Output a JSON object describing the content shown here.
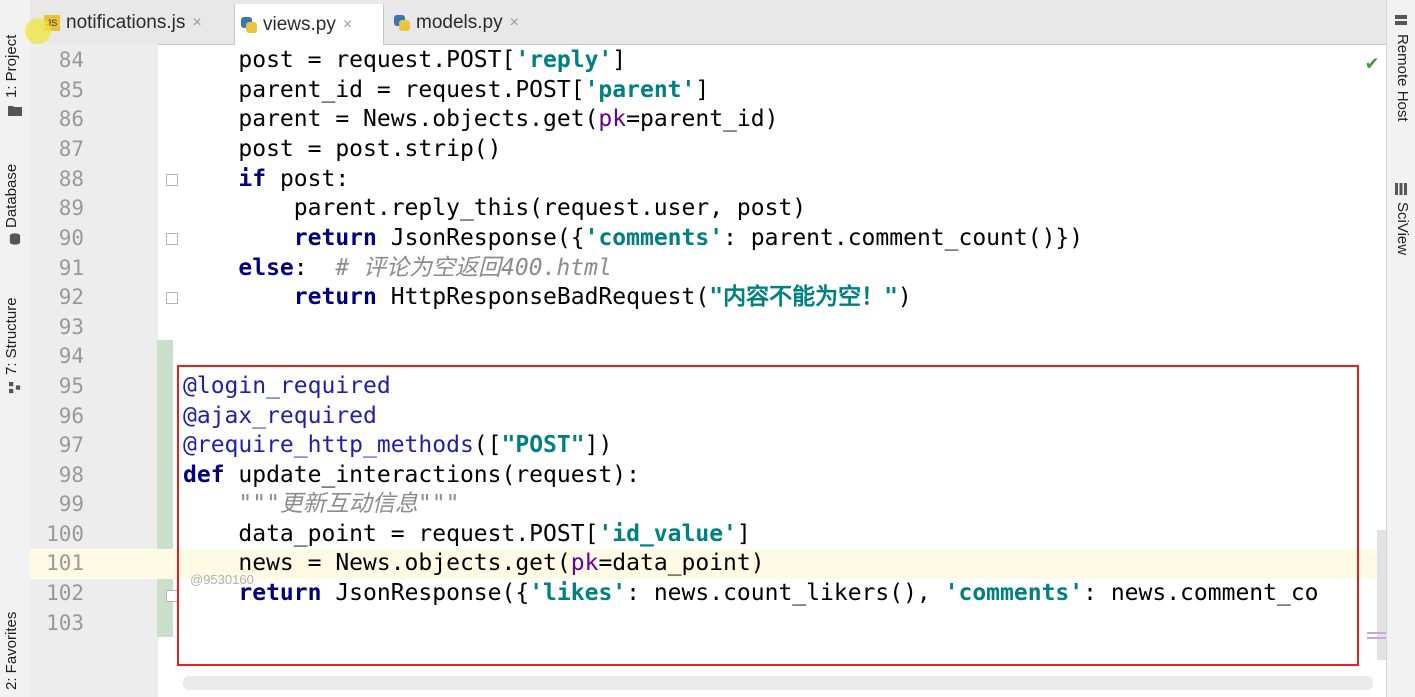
{
  "left_panel": {
    "tabs": [
      {
        "label": "1: Project"
      },
      {
        "label": "Database"
      },
      {
        "label": "7: Structure"
      },
      {
        "label": "2: Favorites"
      }
    ]
  },
  "right_panel": {
    "tabs": [
      {
        "label": "Remote Host"
      },
      {
        "label": "SciView"
      }
    ]
  },
  "editor_tabs": [
    {
      "label": "notifications.js",
      "icon": "js-file-icon",
      "active": false,
      "close": "×"
    },
    {
      "label": "views.py",
      "icon": "python-file-icon",
      "active": true,
      "close": "×"
    },
    {
      "label": "models.py",
      "icon": "python-file-icon",
      "active": false,
      "close": "×"
    }
  ],
  "line_numbers": [
    "84",
    "85",
    "86",
    "87",
    "88",
    "89",
    "90",
    "91",
    "92",
    "93",
    "94",
    "95",
    "96",
    "97",
    "98",
    "99",
    "100",
    "101",
    "102",
    "103"
  ],
  "watermark": "@9530160",
  "status": {
    "check": "✔"
  },
  "colors": {
    "keyword": "#000080",
    "string": "#008080",
    "comment": "#8c8c8c",
    "highlight_box": "#e32121",
    "current_line": "#fffae3"
  },
  "code": {
    "l84": {
      "a": "    post = request.POST[",
      "s": "'reply'",
      "b": "]"
    },
    "l85": {
      "a": "    parent_id = request.POST[",
      "s": "'parent'",
      "b": "]"
    },
    "l86": {
      "a": "    parent = News.objects.get(",
      "p": "pk",
      "b": "=parent_id)"
    },
    "l87": {
      "a": "    post = post.strip()"
    },
    "l88": {
      "kw": "if",
      "b": " post:"
    },
    "l89": {
      "a": "        parent.reply_this(request.user, post)"
    },
    "l90": {
      "kw": "return",
      "a": " JsonResponse({",
      "s": "'comments'",
      "b": ": parent.comment_count()})"
    },
    "l91": {
      "kw": "else",
      "a": ":  ",
      "c": "# 评论为空返回400.html"
    },
    "l92": {
      "kw": "return",
      "a": " HttpResponseBadRequest(",
      "s": "\"内容不能为空！\"",
      "b": ")"
    },
    "l95": {
      "d": "@login_required"
    },
    "l96": {
      "d": "@ajax_required"
    },
    "l97": {
      "d": "@require_http_methods",
      "a": "([",
      "s": "\"POST\"",
      "b": "])"
    },
    "l98": {
      "kw": "def",
      "a": " update_interactions(request):"
    },
    "l99": {
      "c": "\"\"\"更新互动信息\"\"\""
    },
    "l100": {
      "a": "data_point = request.POST[",
      "s": "'id_value'",
      "b": "]"
    },
    "l101": {
      "a": "news = News.objects.get(",
      "p": "pk",
      "b": "=data_point)"
    },
    "l102": {
      "kw": "return",
      "a": " JsonResponse({",
      "s": "'likes'",
      "b": ": news.count_likers(), ",
      "s2": "'comments'",
      "b2": ": news.comment_co"
    }
  }
}
